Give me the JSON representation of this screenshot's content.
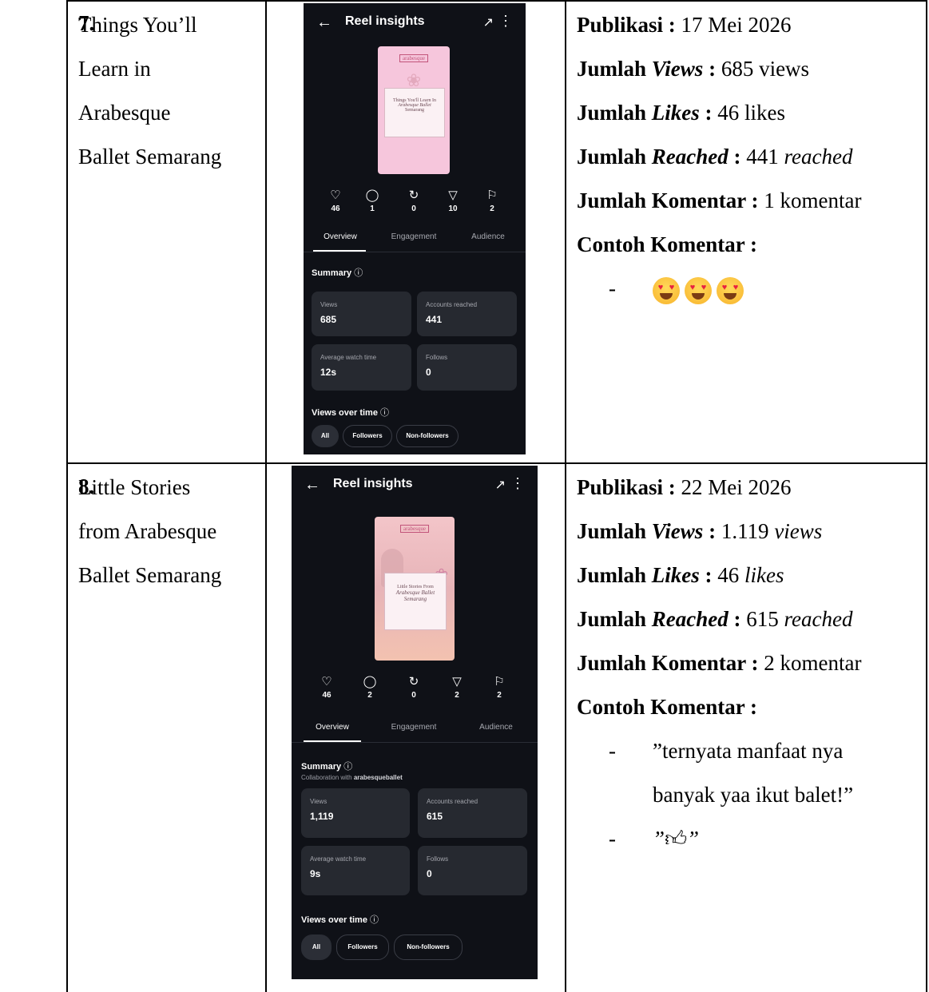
{
  "rows": [
    {
      "number": "7.",
      "title_lines": [
        "Things You’ll",
        "Learn in",
        "Arabesque",
        "Ballet Semarang"
      ],
      "screenshot": {
        "header_title": "Reel insights",
        "thumbnail": {
          "logo": "arabesque",
          "card_lines": [
            "Things You'll Learn In",
            "Arabesque Ballet",
            "Semarang"
          ],
          "background": "#f6c6dc"
        },
        "engagement": [
          {
            "icon": "heart-icon",
            "count": "46"
          },
          {
            "icon": "comment-icon",
            "count": "1"
          },
          {
            "icon": "repost-icon",
            "count": "0"
          },
          {
            "icon": "share-icon",
            "count": "10"
          },
          {
            "icon": "save-icon",
            "count": "2"
          }
        ],
        "tabs": [
          "Overview",
          "Engagement",
          "Audience"
        ],
        "summary_title": "Summary",
        "collab_prefix": "",
        "collab_account": "",
        "stats": [
          {
            "label": "Views",
            "value": "685"
          },
          {
            "label": "Accounts reached",
            "value": "441"
          },
          {
            "label": "Average watch time",
            "value": "12s"
          },
          {
            "label": "Follows",
            "value": "0"
          }
        ],
        "views_over_time": "Views over time",
        "filters": [
          "All",
          "Followers",
          "Non-followers"
        ]
      },
      "info": {
        "publikasi_label": "Publikasi :",
        "publikasi_value": "17 Mei 2026",
        "views_prefix": "Jumlah ",
        "views_label": "Views",
        "views_value": "685",
        "views_unit": "views",
        "likes_prefix": "Jumlah ",
        "likes_label": "Likes",
        "likes_value": "46",
        "likes_unit": "likes",
        "reached_prefix": "Jumlah ",
        "reached_label": "Reached",
        "reached_value": "441",
        "reached_unit": "reached",
        "komentar_label": "Jumlah Komentar :",
        "komentar_value": "1 komentar",
        "contoh_label": "Contoh Komentar :",
        "comments": [
          {
            "dash": "-",
            "emoji_count": 3
          }
        ]
      }
    },
    {
      "number": "8.",
      "title_lines": [
        "Little Stories",
        "from Arabesque",
        "Ballet Semarang"
      ],
      "screenshot": {
        "header_title": "Reel insights",
        "thumbnail": {
          "logo": "arabesque",
          "card_lines": [
            "Little Stories From",
            "Arabesque Ballet",
            "Semarang"
          ],
          "background": "#e9c2c6"
        },
        "engagement": [
          {
            "icon": "heart-icon",
            "count": "46"
          },
          {
            "icon": "comment-icon",
            "count": "2"
          },
          {
            "icon": "repost-icon",
            "count": "0"
          },
          {
            "icon": "share-icon",
            "count": "2"
          },
          {
            "icon": "save-icon",
            "count": "2"
          }
        ],
        "tabs": [
          "Overview",
          "Engagement",
          "Audience"
        ],
        "summary_title": "Summary",
        "collab_prefix": "Collaboration with ",
        "collab_account": "arabesqueballet",
        "stats": [
          {
            "label": "Views",
            "value": "1,119"
          },
          {
            "label": "Accounts reached",
            "value": "615"
          },
          {
            "label": "Average watch time",
            "value": "9s"
          },
          {
            "label": "Follows",
            "value": "0"
          }
        ],
        "views_over_time": "Views over time",
        "filters": [
          "All",
          "Followers",
          "Non-followers"
        ]
      },
      "info": {
        "publikasi_label": "Publikasi :",
        "publikasi_value": "22 Mei 2026",
        "views_prefix": "Jumlah ",
        "views_label": "Views",
        "views_value": "1.119",
        "views_unit": "views",
        "likes_prefix": "Jumlah ",
        "likes_label": "Likes",
        "likes_value": "46",
        "likes_unit": "likes",
        "reached_prefix": "Jumlah ",
        "reached_label": "Reached",
        "reached_value": "615",
        "reached_unit": "reached",
        "komentar_label": "Jumlah Komentar :",
        "komentar_value": "2 komentar",
        "contoh_label": "Contoh Komentar :",
        "comment_1_lines": [
          "”ternyata manfaat nya",
          "banyak yaa ikut balet!”"
        ],
        "comment_2_open": "”",
        "comment_2_icon": "thumbs-up-icon",
        "comment_2_close": "”"
      }
    }
  ],
  "colors": {
    "phone_bg": "#0f1117",
    "stat_bg": "#262930",
    "emoji_eye": "#e8213f"
  }
}
